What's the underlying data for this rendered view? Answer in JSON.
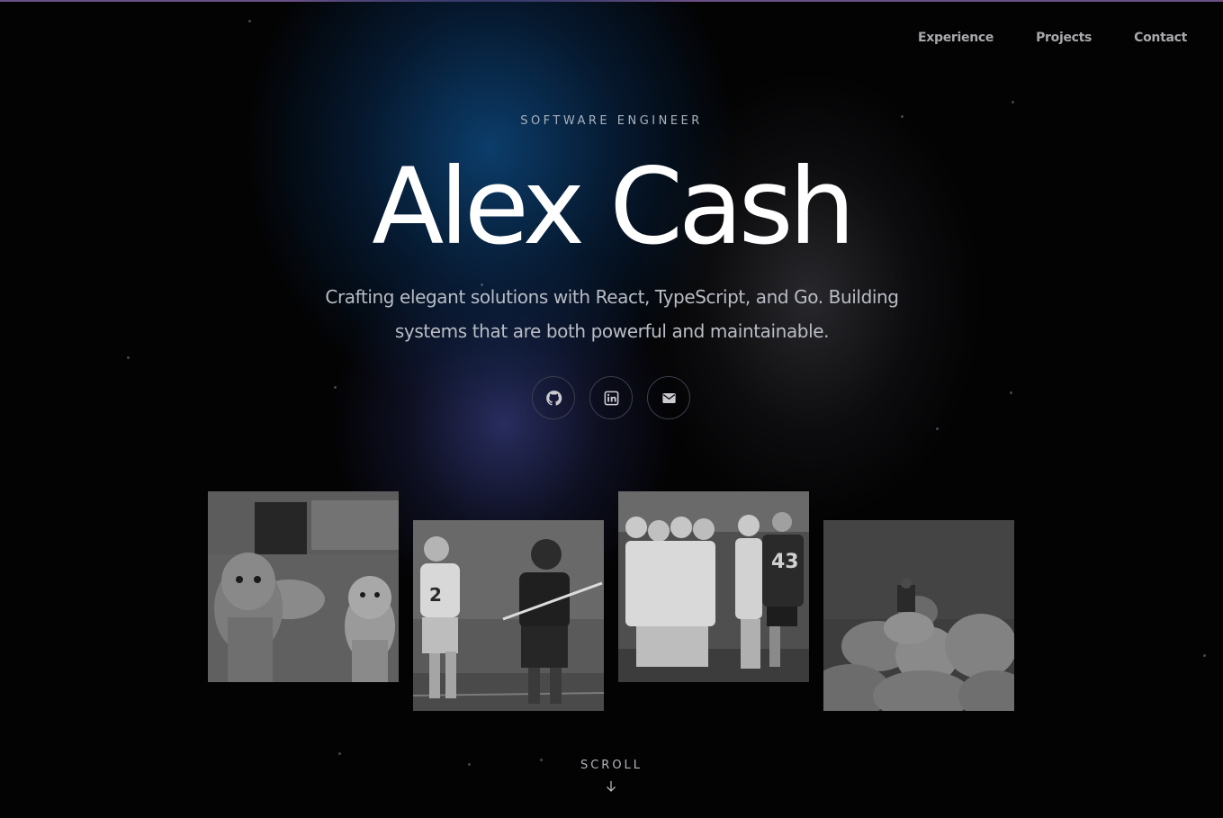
{
  "nav": {
    "items": [
      "Experience",
      "Projects",
      "Contact"
    ]
  },
  "hero": {
    "eyebrow": "SOFTWARE ENGINEER",
    "name": "Alex Cash",
    "tagline_line1": "Crafting elegant solutions with React, TypeScript, and Go. Building",
    "tagline_line2": "systems that are both powerful and maintainable."
  },
  "socials": [
    {
      "icon": "github-icon"
    },
    {
      "icon": "linkedin-icon"
    },
    {
      "icon": "email-icon"
    }
  ],
  "photos": [
    {
      "subject": "two dogs"
    },
    {
      "subject": "lacrosse players"
    },
    {
      "subject": "lacrosse team"
    },
    {
      "subject": "rock summit"
    }
  ],
  "scroll": {
    "label": "SCROLL",
    "icon": "arrow-down-icon"
  },
  "colors": {
    "background": "#030304",
    "accent_top": "#6b4f86",
    "glow_blue": "#0c4070",
    "glow_indigo": "#2e346e"
  }
}
